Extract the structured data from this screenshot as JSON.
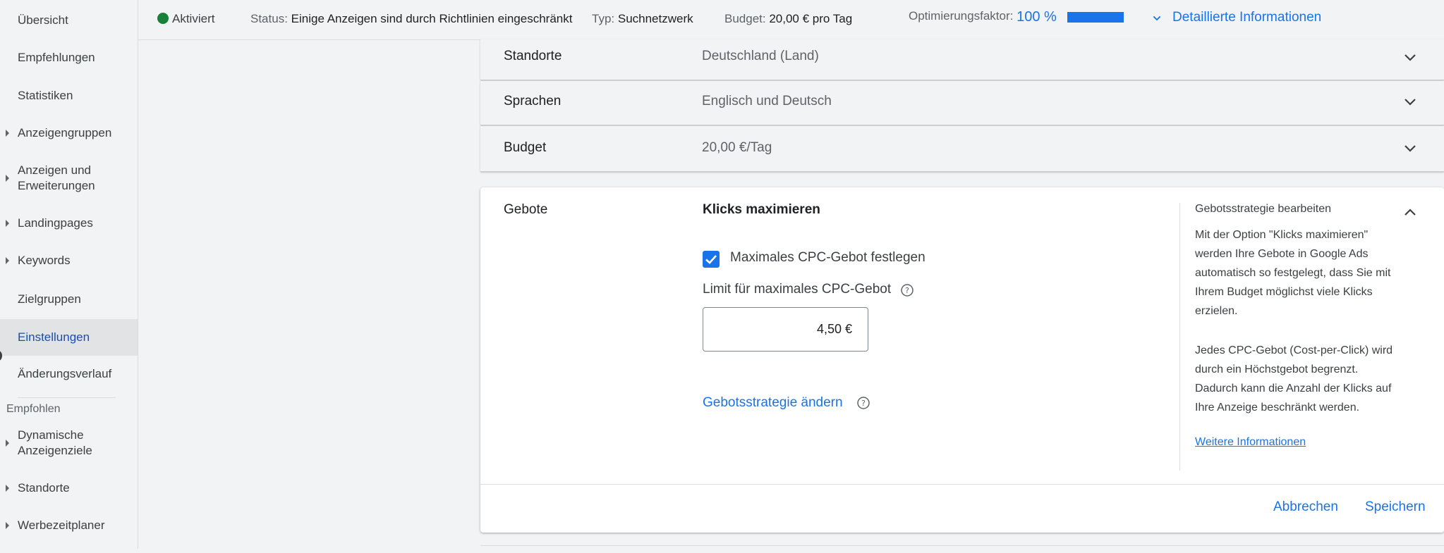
{
  "sidebar": {
    "items": [
      {
        "label": "Übersicht"
      },
      {
        "label": "Empfehlungen"
      },
      {
        "label": "Statistiken"
      },
      {
        "label": "Anzeigengruppen"
      },
      {
        "label": "Anzeigen und Erweiterungen"
      },
      {
        "label": "Landingpages"
      },
      {
        "label": "Keywords"
      },
      {
        "label": "Zielgruppen"
      },
      {
        "label": "Einstellungen"
      },
      {
        "label": "Änderungsverlauf"
      }
    ],
    "section_label": "Empfohlen",
    "recommended": [
      {
        "label": "Dynamische Anzeigenziele"
      },
      {
        "label": "Standorte"
      },
      {
        "label": "Werbezeitplaner"
      }
    ]
  },
  "topbar": {
    "status_active": "Aktiviert",
    "status_key": "Status:",
    "status_value": "Einige Anzeigen sind durch Richtlinien eingeschränkt",
    "type_key": "Typ:",
    "type_value": "Suchnetzwerk",
    "budget_key": "Budget:",
    "budget_value": "20,00 € pro Tag",
    "optimization_key": "Optimierungsfaktor:",
    "optimization_value": "100 %",
    "optimization_fraction": 1.0,
    "details_link": "Detaillierte Informationen"
  },
  "settings": {
    "locations": {
      "title": "Standorte",
      "value": "Deutschland (Land)"
    },
    "languages": {
      "title": "Sprachen",
      "value": "Englisch und Deutsch"
    },
    "budget": {
      "title": "Budget",
      "value": "20,00 €/Tag"
    }
  },
  "bidding": {
    "title": "Gebote",
    "strategy": "Klicks maximieren",
    "checkbox_label": "Maximales CPC-Gebot festlegen",
    "checkbox_checked": true,
    "limit_label": "Limit für maximales CPC-Gebot",
    "limit_value": "4,50 €",
    "change_link": "Gebotsstrategie ändern",
    "side_title": "Gebotsstrategie bearbeiten",
    "side_p1": "Mit der Option \"Klicks maximieren\" werden Ihre Gebote in Google Ads automatisch so festgelegt, dass Sie mit Ihrem Budget möglichst viele Klicks erzielen.",
    "side_p2": "Jedes CPC-Gebot (Cost-per-Click) wird durch ein Höchstgebot begrenzt. Dadurch kann die Anzahl der Klicks auf Ihre Anzeige beschränkt werden.",
    "side_link": "Weitere Informationen",
    "cancel_label": "Abbrechen",
    "save_label": "Speichern"
  },
  "colors": {
    "accent": "#1a73e8",
    "status_green": "#188038",
    "active_nav": "#1a4fb0"
  }
}
